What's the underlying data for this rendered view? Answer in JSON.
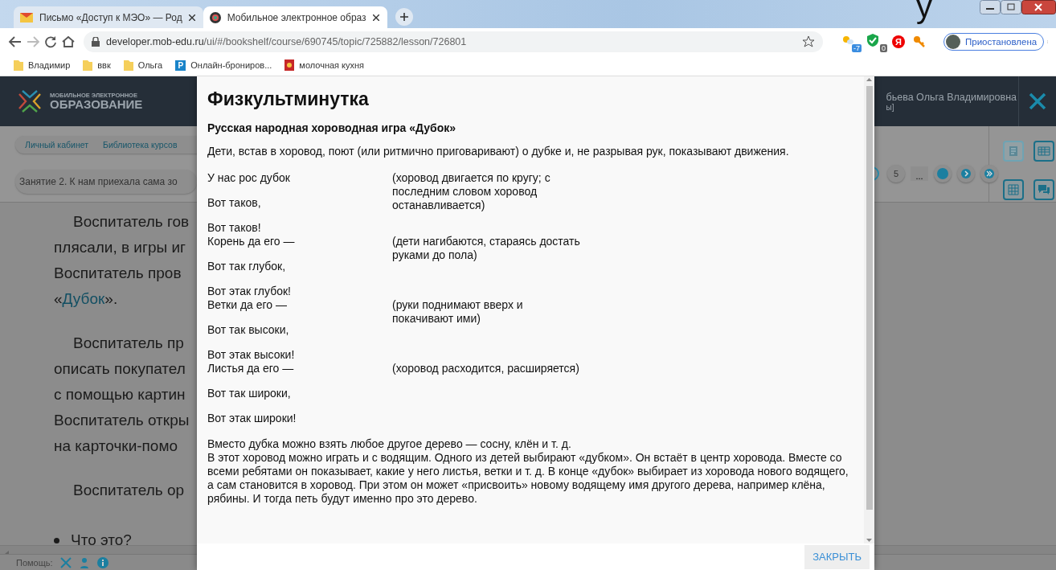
{
  "window": {
    "corner_glyph": "у"
  },
  "tabs": [
    {
      "title": "Письмо «Доступ к МЭО» — Род",
      "selected": false
    },
    {
      "title": "Мобильное электронное образ",
      "selected": true
    }
  ],
  "address_bar": {
    "host": "developer.mob-edu.ru",
    "path": "/ui/#/bookshelf/course/690745/topic/725882/lesson/726801"
  },
  "extensions": [
    {
      "kind": "weather",
      "badge": "-7"
    },
    {
      "kind": "shield",
      "badge": "0"
    },
    {
      "kind": "yandex",
      "glyph": "Я"
    },
    {
      "kind": "key"
    }
  ],
  "profile": {
    "label": "Приостановлена"
  },
  "bookmarks": [
    {
      "kind": "folder",
      "label": "Владимир"
    },
    {
      "kind": "folder",
      "label": "ввк"
    },
    {
      "kind": "folder",
      "label": "Ольга"
    },
    {
      "kind": "p",
      "glyph": "P",
      "label": "Онлайн-брониров..."
    },
    {
      "kind": "emblem",
      "label": "молочная кухня"
    }
  ],
  "site": {
    "logo_top": "МОБИЛЬНОЕ ЭЛЕКТРОННОЕ",
    "logo_bottom": "ОБРАЗОВАНИЕ",
    "user_name": "бьева Ольга Владимировна",
    "user_role": "ы]"
  },
  "breadcrumbs": [
    "Личный кабинет",
    "Библиотека курсов"
  ],
  "lesson_title": "Занятие 2. К нам приехала сама зо",
  "pagination": [
    {
      "kind": "ring"
    },
    {
      "kind": "page",
      "label": "5"
    },
    {
      "kind": "ellipsis",
      "label": "..."
    },
    {
      "kind": "dot"
    },
    {
      "kind": "next"
    },
    {
      "kind": "last"
    }
  ],
  "tools": [
    {
      "kind": "sheet",
      "disabled": true
    },
    {
      "kind": "grid-wide",
      "disabled": false
    },
    {
      "kind": "grid",
      "disabled": false
    },
    {
      "kind": "chat",
      "disabled": false
    }
  ],
  "content_paragraphs": [
    {
      "lines": [
        {
          "text": "Воспитатель гов"
        },
        {
          "text": "плясали, в игры иг"
        },
        {
          "text": "Воспитатель пров"
        },
        {
          "text": "«",
          "link": "Дубок",
          "after": "»."
        }
      ]
    },
    {
      "lines": [
        {
          "text": "Воспитатель пр"
        },
        {
          "text": "описать покупател"
        },
        {
          "text": "с помощью картин"
        },
        {
          "text": "Воспитатель откры"
        },
        {
          "text": "на карточки-помо"
        }
      ]
    },
    {
      "lines": [
        {
          "text": "Воспитатель ор"
        }
      ]
    }
  ],
  "bullet_items": [
    "Что это?"
  ],
  "status_bar": {
    "label": "Помощь:"
  },
  "modal": {
    "title": "Физкультминутка",
    "subtitle": "Русская народная хороводная игра «Дубок»",
    "intro": "Дети, встав в хоровод, поют (или ритмично приговаривают) о дубке и, не разрывая рук, показывают движения.",
    "poem": [
      {
        "lines": [
          "У нас рос дубок",
          "Вот таков,",
          "Вот таков!"
        ],
        "note": "(хоровод двигается по кругу; с последним словом хоровод останавливается)"
      },
      {
        "lines": [
          "Корень да его —",
          "Вот так глубок,",
          "Вот этак глубок!"
        ],
        "note": "(дети нагибаются, стараясь достать руками до пола)"
      },
      {
        "lines": [
          "Ветки да его —",
          "Вот так высоки,",
          "Вот этак высоки!"
        ],
        "note": "(руки поднимают вверх и покачивают ими)"
      },
      {
        "lines": [
          "Листья да его —",
          "Вот так широки,",
          "Вот этак широки!"
        ],
        "note": "(хоровод расходится, расширяется)"
      }
    ],
    "outro": [
      "Вместо дубка можно взять любое другое дерево — сосну, клён и т. д.",
      "В этот хоровод можно играть и с водящим. Одного из детей выбирают «дубком». Он встаёт в центр хоровода. Вместе со всеми ребятами он показывает, какие у него листья, ветки и т. д. В конце «дубок» выбирает из хоровода нового водящего, а сам становится в хоровод. При этом он может «присвоить» новому водящему имя другого дерева, например клёна, рябины. И тогда петь будут именно про это дерево."
    ],
    "close_button": "ЗАКРЫТЬ"
  }
}
